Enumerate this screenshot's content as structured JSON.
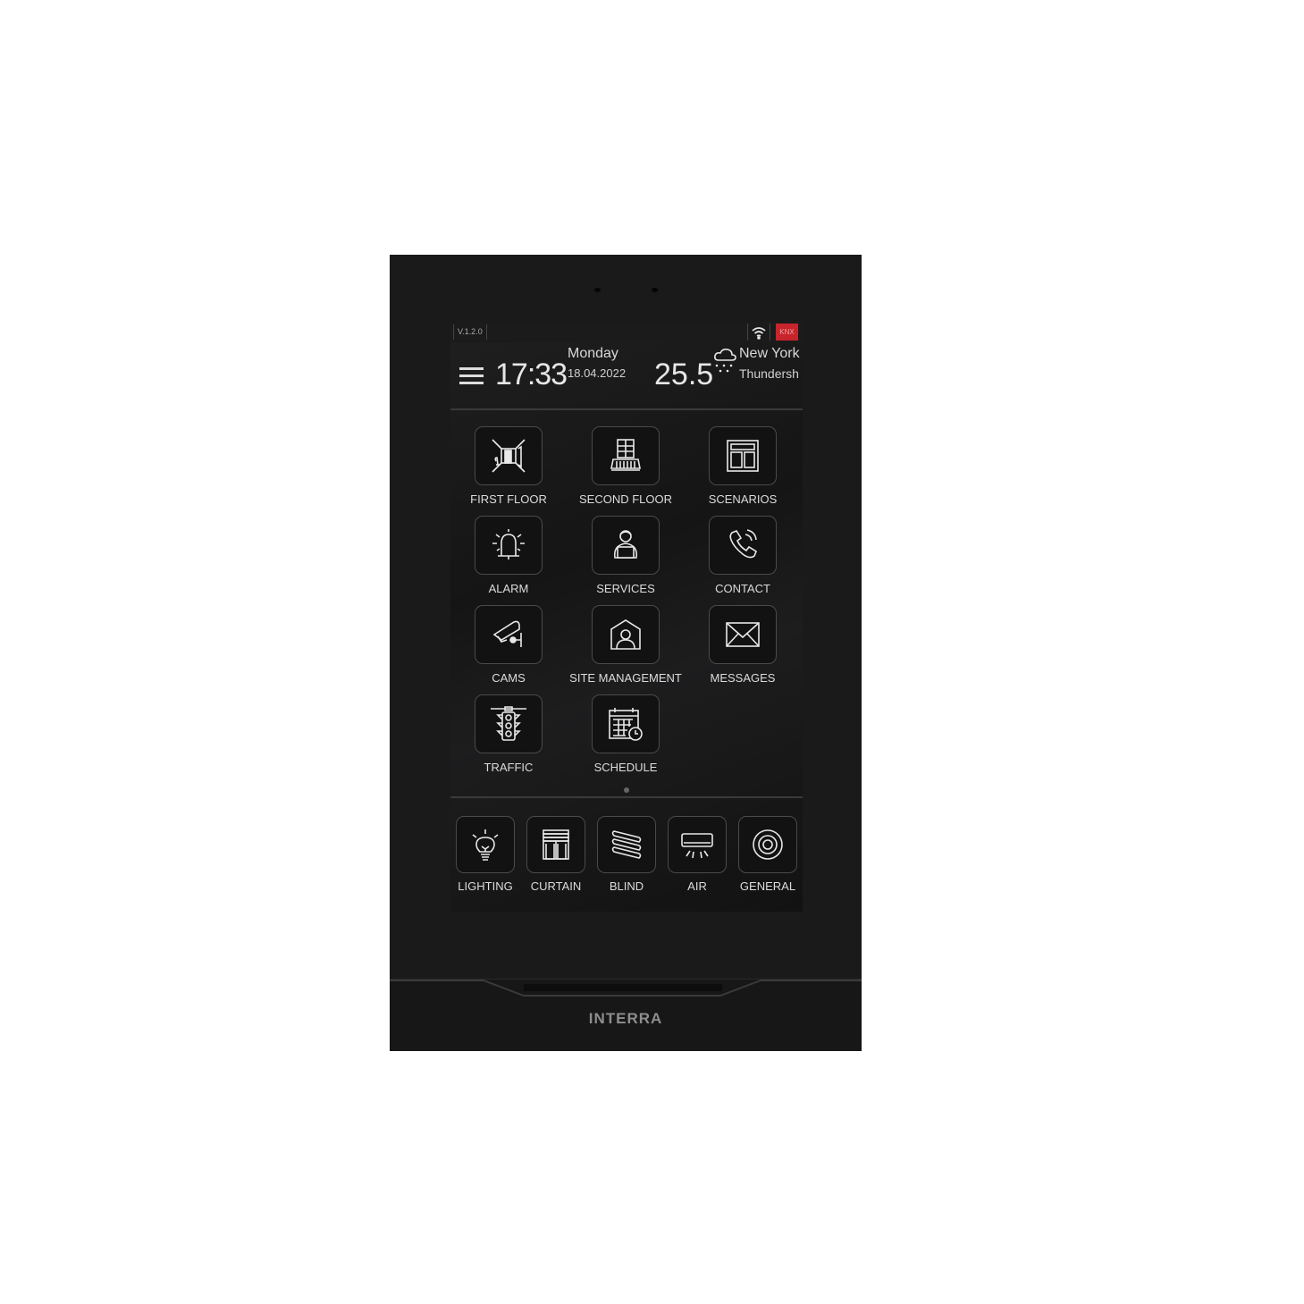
{
  "status_bar": {
    "version": "V.1.2.0",
    "wifi_icon": "wifi-icon",
    "bus_badge": "KNX",
    "bus_badge_color": "#c8242b"
  },
  "header": {
    "menu_icon": "hamburger-menu-icon",
    "time": "17:33",
    "day": "Monday",
    "date": "18.04.2022",
    "temperature": "25.5",
    "weather_icon": "cloud-snow-icon",
    "city": "New York",
    "condition": "Thundersh"
  },
  "grid": [
    {
      "label": "FIRST FLOOR",
      "icon": "room-icon"
    },
    {
      "label": "SECOND FLOOR",
      "icon": "building-balcony-icon"
    },
    {
      "label": "SCENARIOS",
      "icon": "layout-icon"
    },
    {
      "label": "ALARM",
      "icon": "alarm-bell-icon"
    },
    {
      "label": "SERVICES",
      "icon": "person-laptop-icon"
    },
    {
      "label": "CONTACT",
      "icon": "phone-icon"
    },
    {
      "label": "CAMS",
      "icon": "security-camera-icon"
    },
    {
      "label": "SITE MANAGEMENT",
      "icon": "house-person-icon"
    },
    {
      "label": "MESSAGES",
      "icon": "envelope-icon"
    },
    {
      "label": "TRAFFIC",
      "icon": "traffic-light-icon"
    },
    {
      "label": "SCHEDULE",
      "icon": "calendar-clock-icon"
    }
  ],
  "pager": {
    "current_page": 1,
    "total_pages": 1
  },
  "dock": [
    {
      "label": "LIGHTING",
      "icon": "light-bulb-icon"
    },
    {
      "label": "CURTAIN",
      "icon": "curtain-icon"
    },
    {
      "label": "BLIND",
      "icon": "blind-icon"
    },
    {
      "label": "AIR",
      "icon": "air-conditioner-icon"
    },
    {
      "label": "GENERAL",
      "icon": "target-icon"
    }
  ],
  "device": {
    "brand": "INTERRA"
  }
}
